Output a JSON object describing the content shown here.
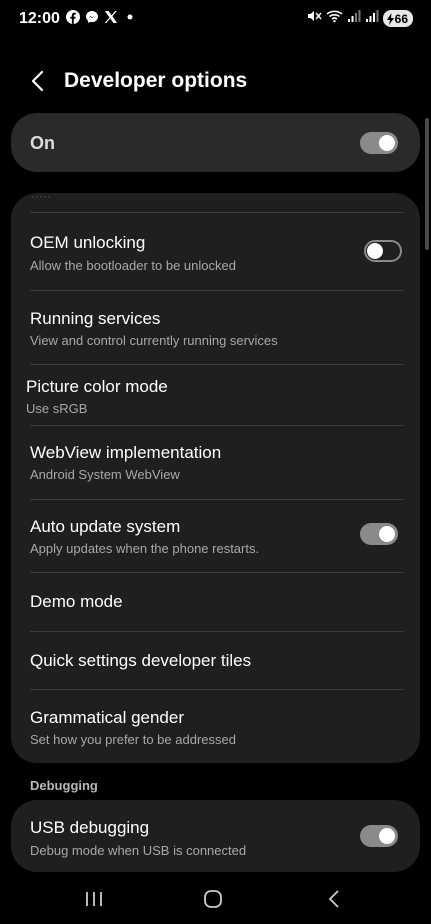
{
  "status": {
    "time": "12:00",
    "notification_icons": [
      "facebook-icon",
      "messenger-icon",
      "x-icon",
      "dot-icon"
    ],
    "battery_level": "66"
  },
  "header": {
    "title": "Developer options"
  },
  "master": {
    "label": "On",
    "state": true
  },
  "items": [
    {
      "title": "OEM unlocking",
      "subtitle": "Allow the bootloader to be unlocked",
      "toggle": false
    },
    {
      "title": "Running services",
      "subtitle": "View and control currently running services"
    },
    {
      "title": "Picture color mode",
      "subtitle": "Use sRGB"
    },
    {
      "title": "WebView implementation",
      "subtitle": "Android System WebView"
    },
    {
      "title": "Auto update system",
      "subtitle": "Apply updates when the phone restarts.",
      "toggle": true
    },
    {
      "title": "Demo mode"
    },
    {
      "title": "Quick settings developer tiles"
    },
    {
      "title": "Grammatical gender",
      "subtitle": "Set how you prefer to be addressed"
    }
  ],
  "debugging": {
    "section_label": "Debugging",
    "usb": {
      "title": "USB debugging",
      "subtitle": "Debug mode when USB is connected",
      "toggle": true
    }
  },
  "colors": {
    "card": "#1f1f1f",
    "master_card": "#2a2a2a",
    "toggle_on": "#8a8a8a",
    "secondary_text": "#a8a8a8"
  }
}
